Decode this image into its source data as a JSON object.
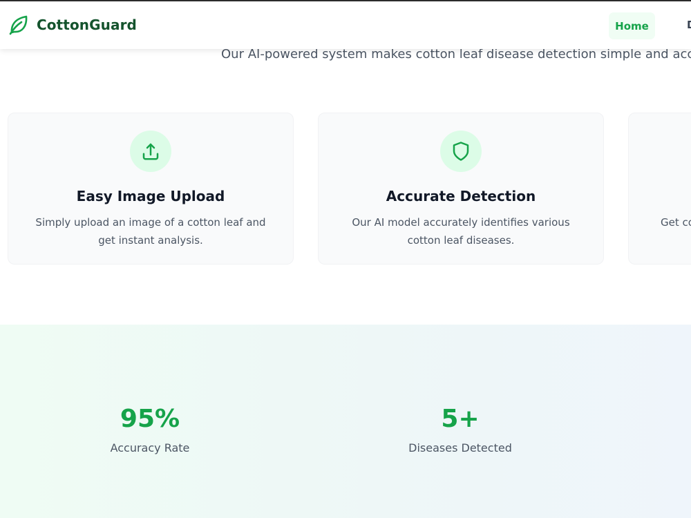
{
  "header": {
    "brand_name": "CottonGuard",
    "nav": {
      "home_label": "Home",
      "next_label_partial": "D"
    }
  },
  "hero": {
    "subtitle": "Our AI-powered system makes cotton leaf disease detection simple and accurat"
  },
  "features": [
    {
      "icon": "upload-icon",
      "title": "Easy Image Upload",
      "description": "Simply upload an image of a cotton leaf and get instant analysis."
    },
    {
      "icon": "shield-icon",
      "title": "Accurate Detection",
      "description": "Our AI model accurately identifies various cotton leaf diseases."
    },
    {
      "icon": "",
      "title": "",
      "description": "Get co"
    }
  ],
  "stats": [
    {
      "value": "95%",
      "label": "Accuracy Rate"
    },
    {
      "value": "5+",
      "label": "Diseases Detected"
    }
  ],
  "colors": {
    "brand_dark": "#14532d",
    "accent": "#16a34a",
    "accent_light": "#dcfce7",
    "nav_active_bg": "#f0fdf4",
    "card_bg": "#f9fafb"
  }
}
